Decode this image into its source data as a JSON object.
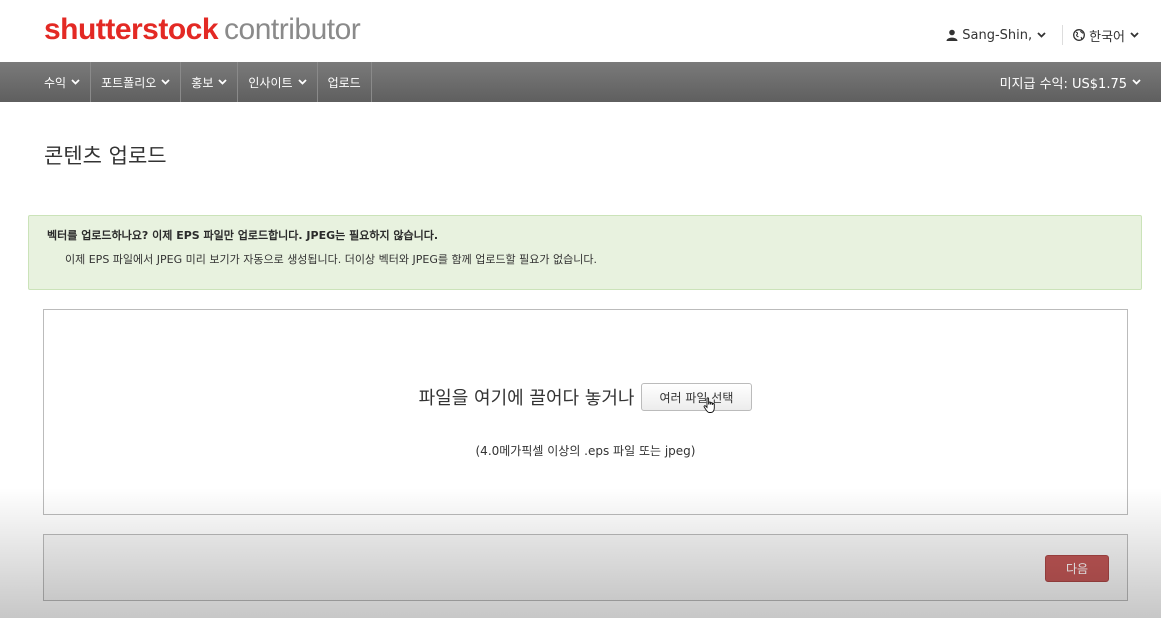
{
  "header": {
    "logo_brand": "shutterstock",
    "logo_suffix": "contributor",
    "user_name": "Sang-Shin,",
    "language": "한국어"
  },
  "nav": {
    "items": [
      {
        "label": "수익",
        "dropdown": true
      },
      {
        "label": "포트폴리오",
        "dropdown": true
      },
      {
        "label": "홍보",
        "dropdown": true
      },
      {
        "label": "인사이트",
        "dropdown": true
      },
      {
        "label": "업로드",
        "dropdown": false
      }
    ],
    "earnings": "미지급 수익: US$1.75"
  },
  "page": {
    "title": "콘텐츠 업로드"
  },
  "alert": {
    "title": "벡터를 업로드하나요? 이제 EPS 파일만 업로드합니다. JPEG는 필요하지 않습니다.",
    "body": "이제 EPS 파일에서 JPEG 미리 보기가 자동으로 생성됩니다. 더이상 벡터와 JPEG를 함께 업로드할 필요가 없습니다."
  },
  "dropzone": {
    "text": "파일을 여기에 끌어다 놓거나",
    "button_label": "여러 파일 선택",
    "hint": "(4.0메가픽셀 이상의 .eps 파일 또는 jpeg)"
  },
  "footer": {
    "next_label": "다음"
  },
  "colors": {
    "brand_red": "#e32924",
    "nav_bg": "#6b6b6b",
    "alert_bg": "#e8f2df",
    "next_button": "#c25756"
  }
}
